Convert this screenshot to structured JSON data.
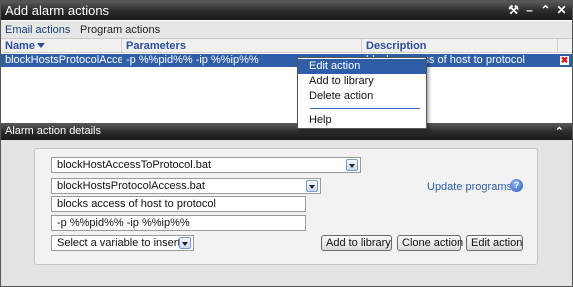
{
  "window": {
    "title": "Add alarm actions",
    "icons": [
      "tools-icon",
      "minimize-icon",
      "collapse-icon",
      "close-icon"
    ]
  },
  "tabs": [
    {
      "label": "Email actions",
      "active": true
    },
    {
      "label": "Program actions",
      "active": false
    }
  ],
  "grid": {
    "columns": [
      "Name",
      "Parameters",
      "Description"
    ],
    "rows": [
      {
        "name": "blockHostsProtocolAccess.",
        "parameters": "-p %%pid%% -ip %%ip%%",
        "description": "blocks access of host to protocol",
        "selected": true
      }
    ]
  },
  "context_menu": {
    "items": [
      "Edit action",
      "Add to library",
      "Delete action",
      "Help"
    ],
    "highlighted": "Edit action"
  },
  "details": {
    "title": "Alarm action details",
    "program_select": "blockHostAccessToProtocol.bat",
    "action_select": "blockHostsProtocolAccess.bat",
    "description_value": "blocks access of host to protocol",
    "parameters_value": "-p %%pid%% -ip %%ip%%",
    "variable_select": "Select a variable to insert",
    "update_programs_label": "Update programs",
    "buttons": {
      "add_to_library": "Add to library",
      "clone_action": "Clone action",
      "edit_action": "Edit action"
    }
  },
  "colors": {
    "titlebar": "#2a2a2a",
    "selection": "#2f5ea8",
    "header_text": "#2a4f9c",
    "link": "#2f5ea8"
  }
}
